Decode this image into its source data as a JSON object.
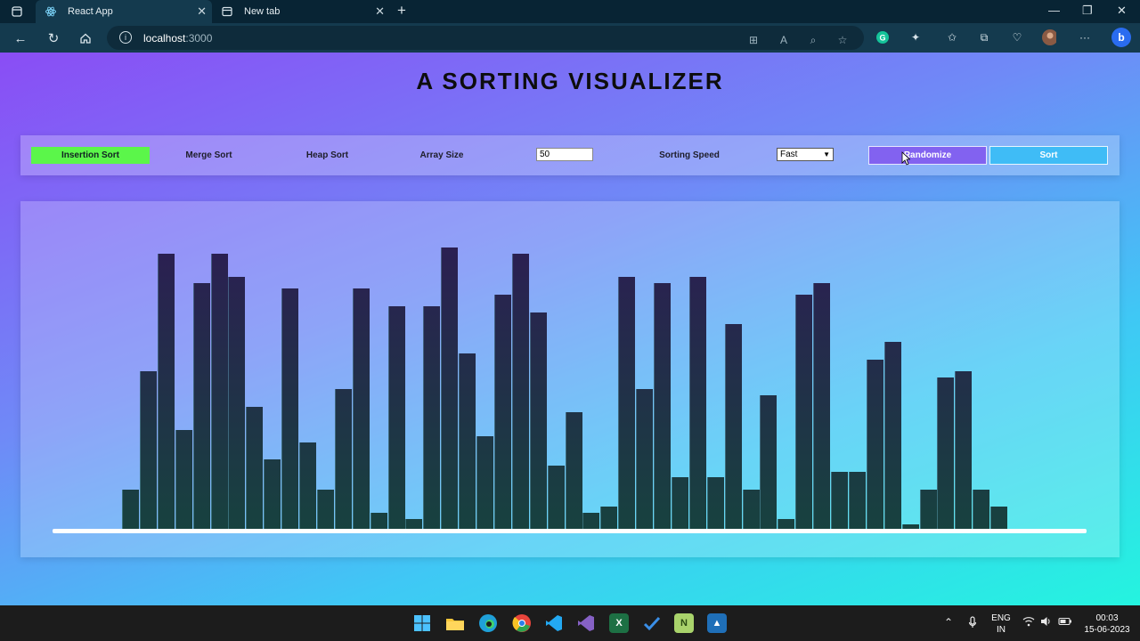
{
  "browser": {
    "tabs": [
      {
        "title": "React App",
        "active": true
      },
      {
        "title": "New tab",
        "active": false
      }
    ],
    "new_tab_symbol": "+",
    "url_host": "localhost",
    "url_port": ":3000",
    "window_controls": [
      "—",
      "❐",
      "✕"
    ]
  },
  "app": {
    "title": "A SORTING VISUALIZER",
    "controls": {
      "algorithms": [
        {
          "label": "Insertion Sort",
          "selected": true
        },
        {
          "label": "Merge Sort",
          "selected": false
        },
        {
          "label": "Heap Sort",
          "selected": false
        }
      ],
      "array_size_label": "Array Size",
      "array_size_value": "50",
      "speed_label": "Sorting Speed",
      "speed_value": "Fast",
      "randomize_label": "Randomize",
      "sort_label": "Sort"
    },
    "array_values": [
      7,
      27,
      47,
      17,
      42,
      47,
      43,
      21,
      12,
      41,
      15,
      7,
      24,
      41,
      3,
      38,
      2,
      38,
      48,
      30,
      16,
      40,
      47,
      37,
      11,
      20,
      3,
      4,
      43,
      24,
      42,
      9,
      43,
      9,
      35,
      7,
      23,
      2,
      40,
      42,
      10,
      10,
      29,
      32,
      1,
      7,
      26,
      27,
      7,
      4
    ],
    "colors": {
      "bar_top": "#2b1f52",
      "bar_bottom": "#17423f",
      "active_algorithm": "#5bf64a",
      "randomize_button": "#8262f0",
      "sort_button": "#3fbcf6"
    }
  },
  "taskbar": {
    "apps": [
      "windows-start",
      "file-explorer",
      "edge",
      "chrome",
      "vscode",
      "visual-studio",
      "excel",
      "todo",
      "notepad-plus",
      "photos"
    ],
    "language_line1": "ENG",
    "language_line2": "IN",
    "time": "00:03",
    "date": "15-06-2023"
  }
}
